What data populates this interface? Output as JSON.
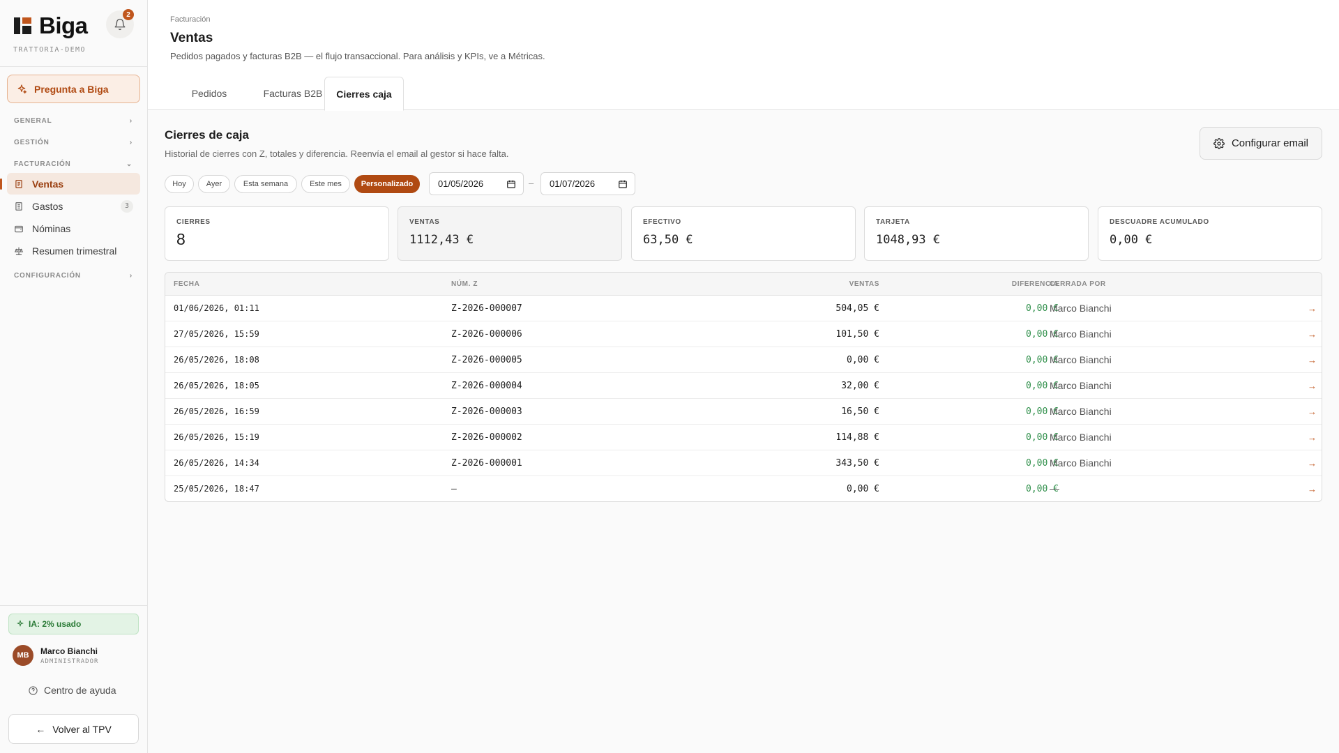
{
  "sidebar": {
    "brand": "Biga",
    "tenant": "TRATTORIA-DEMO",
    "notifications": "2",
    "ask_label": "Pregunta a Biga",
    "sections": {
      "general": "GENERAL",
      "gestion": "GESTIÓN",
      "facturacion": "FACTURACIÓN",
      "configuracion": "CONFIGURACIÓN"
    },
    "items": [
      {
        "label": "Ventas",
        "icon": "receipt-icon",
        "active": true
      },
      {
        "label": "Gastos",
        "icon": "document-icon",
        "count": "3"
      },
      {
        "label": "Nóminas",
        "icon": "wallet-icon"
      },
      {
        "label": "Resumen trimestral",
        "icon": "scale-icon"
      }
    ],
    "ia_usage": "IA: 2% usado",
    "user": {
      "initials": "MB",
      "name": "Marco Bianchi",
      "role": "ADMINISTRADOR"
    },
    "help": "Centro de ayuda",
    "back": "Volver al TPV"
  },
  "header": {
    "breadcrumb": "Facturación",
    "title": "Ventas",
    "subtitle": "Pedidos pagados y facturas B2B — el flujo transaccional. Para análisis y KPIs, ve a Métricas.",
    "tabs": [
      "Pedidos",
      "Facturas B2B",
      "Cierres caja"
    ],
    "active_tab": "Cierres caja"
  },
  "main": {
    "title": "Cierres de caja",
    "subtitle": "Historial de cierres con Z, totales y diferencia. Reenvía el email al gestor si hace falta.",
    "config_button": "Configurar email",
    "filters": [
      "Hoy",
      "Ayer",
      "Esta semana",
      "Este mes",
      "Personalizado"
    ],
    "active_filter": "Personalizado",
    "date_from": "01/05/2026",
    "date_to": "01/07/2026",
    "date_separator": "–",
    "kpis": [
      {
        "label": "CIERRES",
        "value": "8"
      },
      {
        "label": "VENTAS",
        "value": "1112,43 €"
      },
      {
        "label": "EFECTIVO",
        "value": "63,50 €"
      },
      {
        "label": "TARJETA",
        "value": "1048,93 €"
      },
      {
        "label": "DESCUADRE ACUMULADO",
        "value": "0,00 €"
      }
    ],
    "table": {
      "columns": [
        "FECHA",
        "NÚM. Z",
        "VENTAS",
        "DIFERENCIA",
        "CERRADA POR"
      ],
      "rows": [
        {
          "fecha": "01/06/2026, 01:11",
          "z": "Z-2026-000007",
          "ventas": "504,05 €",
          "diferencia": "0,00 €",
          "cerrada_por": "Marco Bianchi",
          "action": "→"
        },
        {
          "fecha": "27/05/2026, 15:59",
          "z": "Z-2026-000006",
          "ventas": "101,50 €",
          "diferencia": "0,00 €",
          "cerrada_por": "Marco Bianchi",
          "action": "→"
        },
        {
          "fecha": "26/05/2026, 18:08",
          "z": "Z-2026-000005",
          "ventas": "0,00 €",
          "diferencia": "0,00 €",
          "cerrada_por": "Marco Bianchi",
          "action": "→"
        },
        {
          "fecha": "26/05/2026, 18:05",
          "z": "Z-2026-000004",
          "ventas": "32,00 €",
          "diferencia": "0,00 €",
          "cerrada_por": "Marco Bianchi",
          "action": "→"
        },
        {
          "fecha": "26/05/2026, 16:59",
          "z": "Z-2026-000003",
          "ventas": "16,50 €",
          "diferencia": "0,00 €",
          "cerrada_por": "Marco Bianchi",
          "action": "→"
        },
        {
          "fecha": "26/05/2026, 15:19",
          "z": "Z-2026-000002",
          "ventas": "114,88 €",
          "diferencia": "0,00 €",
          "cerrada_por": "Marco Bianchi",
          "action": "→"
        },
        {
          "fecha": "26/05/2026, 14:34",
          "z": "Z-2026-000001",
          "ventas": "343,50 €",
          "diferencia": "0,00 €",
          "cerrada_por": "Marco Bianchi",
          "action": "→"
        },
        {
          "fecha": "25/05/2026, 18:47",
          "z": "—",
          "ventas": "0,00 €",
          "diferencia": "0,00 €",
          "cerrada_por": "—",
          "action": "→"
        }
      ]
    }
  },
  "colors": {
    "accent": "#c0561d",
    "positive": "#2f8f4a"
  }
}
